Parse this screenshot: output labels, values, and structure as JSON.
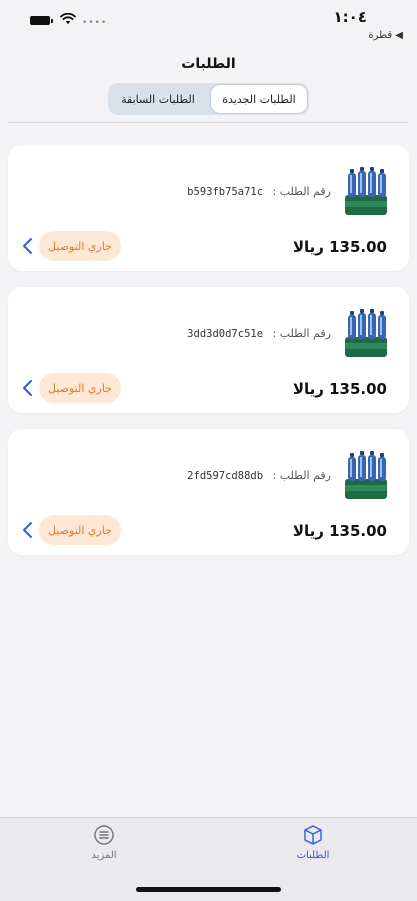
{
  "status_bar": {
    "time": "١:٠٤",
    "back_label": "◀ قطرة"
  },
  "header": {
    "title": "الطلبات"
  },
  "segments": {
    "new_label": "الطلبات الجديدة",
    "past_label": "الطلبات السابقة",
    "active": "new"
  },
  "orders": [
    {
      "order_label": "رقم الطلب :",
      "order_id": "b593fb75a71c",
      "price": "135.00 ريالا",
      "status": "جاري التوصيل"
    },
    {
      "order_label": "رقم الطلب :",
      "order_id": "3dd3d0d7c51e",
      "price": "135.00 ريالا",
      "status": "جاري التوصيل"
    },
    {
      "order_label": "رقم الطلب :",
      "order_id": "2fd597cd88db",
      "price": "135.00 ريالا",
      "status": "جاري التوصيل"
    }
  ],
  "tab_bar": {
    "orders_label": "الطلبات",
    "more_label": "المزيد"
  },
  "colors": {
    "accent": "#2f5fd6",
    "status_bg": "#fde8d6",
    "status_text": "#e57b2e",
    "segment_bg": "#dbe1ea"
  },
  "icons": {
    "product": "water-pack-icon",
    "chevron": "chevron-left-icon",
    "orders_tab": "box-icon",
    "more_tab": "menu-circle-icon"
  }
}
